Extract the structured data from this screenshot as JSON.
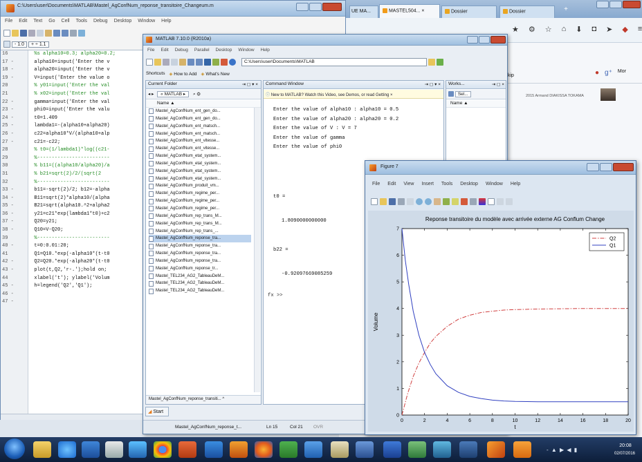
{
  "browser": {
    "tabs": [
      "UE MA...",
      "MASTEL504... ×",
      "Dossier",
      "Dossier",
      "+"
    ],
    "page_text": [
      "2015 Armand DIAKISSA TOKAMA"
    ],
    "side_labels": [
      "kip",
      "Mor"
    ]
  },
  "editor": {
    "title": "C:\\Users\\user\\Documents\\MATLAB\\Mastel_AgConfNum_reponse_transitoire_Changeum.m",
    "menu": [
      "File",
      "Edit",
      "Text",
      "Go",
      "Cell",
      "Tools",
      "Debug",
      "Desktop",
      "Window",
      "Help"
    ],
    "toolbar_value": "- 1.0",
    "toolbar_plus": "+ ÷ 1.1",
    "lines": [
      {
        "n": "16",
        "d": "",
        "code": "  %s alpha10=0.3; alpha20=0.2;"
      },
      {
        "n": "17",
        "d": "-",
        "code": "  alpha10=input('Enter the v"
      },
      {
        "n": "18",
        "d": "-",
        "code": "  alpha20=input('Enter the v"
      },
      {
        "n": "19",
        "d": "-",
        "code": "  V=input('Enter the value o"
      },
      {
        "n": "20",
        "d": "",
        "code": "  % y01=input('Enter the val"
      },
      {
        "n": "21",
        "d": "",
        "code": "  % x02=input('Enter the val"
      },
      {
        "n": "22",
        "d": "-",
        "code": "  gamma=input('Enter the val"
      },
      {
        "n": "23",
        "d": "-",
        "code": "  phi0=input('Enter the valu"
      },
      {
        "n": "24",
        "d": "-",
        "code": "  t0=1.409"
      },
      {
        "n": "25",
        "d": "-",
        "code": "  lambda1=-(alpha10+alpha20)"
      },
      {
        "n": "26",
        "d": "-",
        "code": "  c22=alpha10*V/(alpha10+alp"
      },
      {
        "n": "27",
        "d": "-",
        "code": "  c21=-c22;"
      },
      {
        "n": "28",
        "d": "",
        "code": "  % t0=(1/lambda1)*log((c21-"
      },
      {
        "n": "29",
        "d": "",
        "code": "  %-------------------------"
      },
      {
        "n": "30",
        "d": "",
        "code": "  % b11=((alpha10/alpha20)/a"
      },
      {
        "n": "31",
        "d": "",
        "code": "  % b21=sqrt(2)/2/(sqrt(2"
      },
      {
        "n": "32",
        "d": "",
        "code": "  %-------------------------"
      },
      {
        "n": "33",
        "d": "-",
        "code": "  b11=-sqrt(2)/2; b12=-alpha"
      },
      {
        "n": "34",
        "d": "-",
        "code": "  B11=sqrt(2)*alpha10/(alpha"
      },
      {
        "n": "35",
        "d": "-",
        "code": "  B21=sqrt(alpha10.^2+alpha2"
      },
      {
        "n": "36",
        "d": "-",
        "code": "  y21=c21*exp(lambda1*t0)+c2"
      },
      {
        "n": "37",
        "d": "-",
        "code": "  Q20=y21;"
      },
      {
        "n": "38",
        "d": "-",
        "code": "  Q10=V-Q20;"
      },
      {
        "n": "39",
        "d": "",
        "code": "  %-------------------------"
      },
      {
        "n": "40",
        "d": "-",
        "code": "  t=0:0.01:20;"
      },
      {
        "n": "41",
        "d": "",
        "code": ""
      },
      {
        "n": "42",
        "d": "-",
        "code": "  Q1=Q10.*exp(-alpha10*(t-t0"
      },
      {
        "n": "43",
        "d": "-",
        "code": "  Q2=Q20.*exp(-alpha20*(t-t0"
      },
      {
        "n": "44",
        "d": "",
        "code": ""
      },
      {
        "n": "45",
        "d": "-",
        "code": "  plot(t,Q2,'r-.');hold on;"
      },
      {
        "n": "46",
        "d": "-",
        "code": "  xlabel('t'); ylabel('Volum"
      },
      {
        "n": "47",
        "d": "-",
        "code": "  h=legend('Q2','Q1');"
      }
    ]
  },
  "matlab": {
    "title": "MATLAB 7.10.0 (R2010a)",
    "menu": [
      "File",
      "Edit",
      "Debug",
      "Parallel",
      "Desktop",
      "Window",
      "Help"
    ],
    "path": "C:\\Users\\user\\Documents\\MATLAB",
    "shortcuts": [
      "Shortcuts",
      "How to Add",
      "What's New"
    ],
    "current_folder": {
      "title": "Current Folder",
      "crumb": "« MATLAB ▸",
      "header": "Name ▲",
      "files": [
        "Mastel_AgConfNum_ent_gen_do...",
        "Mastel_AgConfNum_ent_gen_do...",
        "Mastel_AgConfNum_ent_matsch...",
        "Mastel_AgConfNum_ent_matsch...",
        "Mastel_AgConfNum_ent_vitesse...",
        "Mastel_AgConfNum_ent_vitesse...",
        "Mastel_AgConfNum_etat_system...",
        "Mastel_AgConfNum_etat_system...",
        "Mastel_AgConfNum_etat_system...",
        "Mastel_AgConfNum_etat_system...",
        "Mastel_AgConfNum_produit_vm...",
        "Mastel_AgConfNum_regime_per...",
        "Mastel_AgConfNum_regime_per...",
        "Mastel_AgConfNum_regime_per...",
        "Mastel_AgConfNum_rep_trans_M...",
        "Mastel_AgConfNum_rep_trans_M...",
        "Mastel_AgConfNum_rep_trans_...",
        "Mastel_AgConfNum_reponse_tra...",
        "Mastel_AgConfNum_reponse_tra...",
        "Mastel_AgConfNum_reponse_tra...",
        "Mastel_AgConfNum_reponse_tra...",
        "Mastel_AgConfNum_reponse_tr...",
        "Mastel_TEL234_AG2_TableauDeM...",
        "Mastel_TEL234_AG2_TableauDeM...",
        "Mastel_TEL234_AG2_TableauDeM..."
      ],
      "selected_index": 17,
      "footer": "Mastel_AgConfNum_reponse_transiti... ^"
    },
    "command_window": {
      "title": "Command Window",
      "banner": "New to MATLAB? Watch this Video, see Demos, or read Getting ×",
      "lines": [
        "Enter the value of alpha10 : alpha10 = 0.5",
        "Enter the value of alpha20 : alpha20 = 0.2",
        "Enter the value of V : V = 7",
        "Enter the value of gamma",
        "Enter the value of phi0"
      ],
      "var1": "t0 =",
      "val1": "1.8090000000000",
      "var2": "b22 =",
      "val2": "-0.92097669085259",
      "prompt": "fx >>"
    },
    "workspace": {
      "title": "Works...",
      "name_col": "Name ▲",
      "sel": "Sel..."
    },
    "start": "Start",
    "status": [
      "Mastel_AgConfNum_reponse_t...",
      "Ln 15",
      "Col 21",
      "OVR"
    ]
  },
  "figure": {
    "title": "Figure 7",
    "menu": [
      "File",
      "Edit",
      "View",
      "Insert",
      "Tools",
      "Desktop",
      "Window",
      "Help"
    ]
  },
  "chart_data": {
    "type": "line",
    "title": "Reponse transitoire du modèle avec arrivée externe AG Conflum Change",
    "xlabel": "t",
    "ylabel": "Volume",
    "xlim": [
      0,
      20
    ],
    "ylim": [
      0,
      7
    ],
    "xticks": [
      "0",
      "2",
      "4",
      "6",
      "8",
      "10",
      "12",
      "14",
      "16",
      "18",
      "20"
    ],
    "yticks": [
      "0",
      "1",
      "2",
      "3",
      "4",
      "5",
      "6",
      "7"
    ],
    "legend_position": "top-right",
    "series": [
      {
        "name": "Q2",
        "color": "#d04040",
        "style": "dash-dot",
        "x": [
          0,
          0.5,
          1,
          1.5,
          2,
          2.5,
          3,
          4,
          5,
          6,
          7,
          8,
          9,
          10,
          12,
          14,
          16,
          18,
          20
        ],
        "y": [
          0,
          0.8,
          1.45,
          1.95,
          2.35,
          2.7,
          2.95,
          3.33,
          3.6,
          3.75,
          3.85,
          3.9,
          3.94,
          3.96,
          3.98,
          3.99,
          4.0,
          4.0,
          4.0
        ]
      },
      {
        "name": "Q1",
        "color": "#3040c0",
        "style": "solid",
        "x": [
          0,
          0.3,
          0.6,
          1,
          1.5,
          2,
          2.5,
          3,
          4,
          5,
          6,
          7,
          8,
          9,
          10,
          12,
          14,
          16,
          18,
          20
        ],
        "y": [
          7,
          5.8,
          4.9,
          3.9,
          3.0,
          2.35,
          1.9,
          1.55,
          1.1,
          0.85,
          0.7,
          0.62,
          0.56,
          0.53,
          0.51,
          0.5,
          0.5,
          0.5,
          0.5,
          0.5
        ]
      }
    ]
  },
  "taskbar": {
    "clock": "20:08",
    "date": "02/07/2016",
    "tray": "- ▲ ▶ ◀ ▮"
  }
}
